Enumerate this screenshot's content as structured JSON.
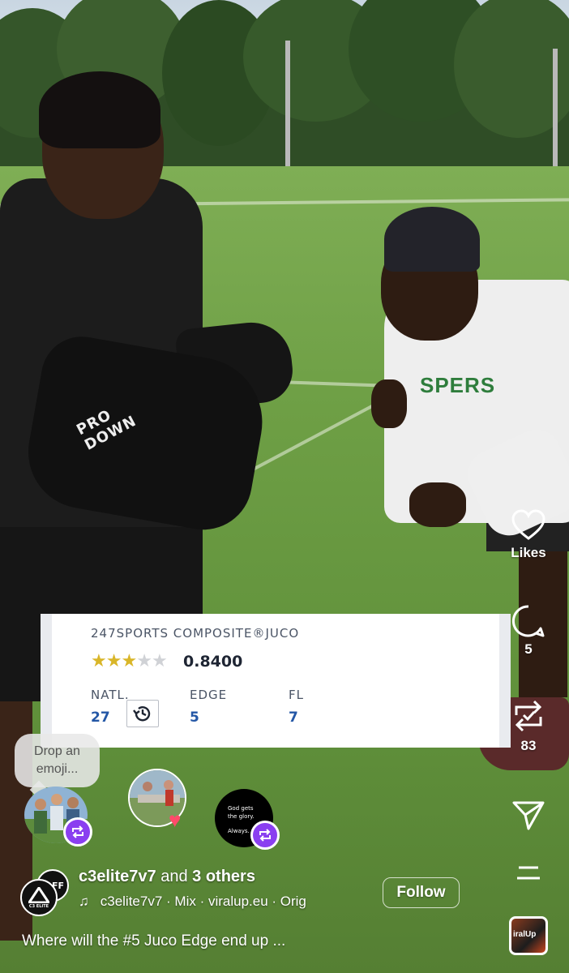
{
  "rank_card": {
    "title": "247SPORTS COMPOSITE®JUCO",
    "stars_filled": 3,
    "stars_total": 5,
    "score": "0.8400",
    "columns": [
      {
        "label": "NATL.",
        "value": "27"
      },
      {
        "label": "EDGE",
        "value": "5"
      },
      {
        "label": "FL",
        "value": "7"
      }
    ]
  },
  "rail": {
    "likes_label": "Likes",
    "comments_count": "5",
    "reposts_count": "83"
  },
  "reactions": {
    "emoji_prompt": "Drop an emoji...",
    "black_post_text_1": "God gets the glory.",
    "black_post_text_2": "Always."
  },
  "post": {
    "author": "c3elite7v7",
    "and_text": "and",
    "others": "3 others",
    "audio": "c3elite7v7 · Mix · viralup.eu · Orig",
    "follow_label": "Follow",
    "caption": "Where will the #5 Juco Edge end up ..."
  },
  "logos": {
    "front_text": "C3 ELITE",
    "back_text": "FF",
    "album_text": "iralUp",
    "pad_text": "PRO DOWN",
    "shirt_text": "SPERS"
  },
  "colors": {
    "star_filled": "#d9b629",
    "star_empty": "#d0d2d6",
    "rank_value": "#2457a6",
    "repost_badge": "#8a3ff0"
  }
}
